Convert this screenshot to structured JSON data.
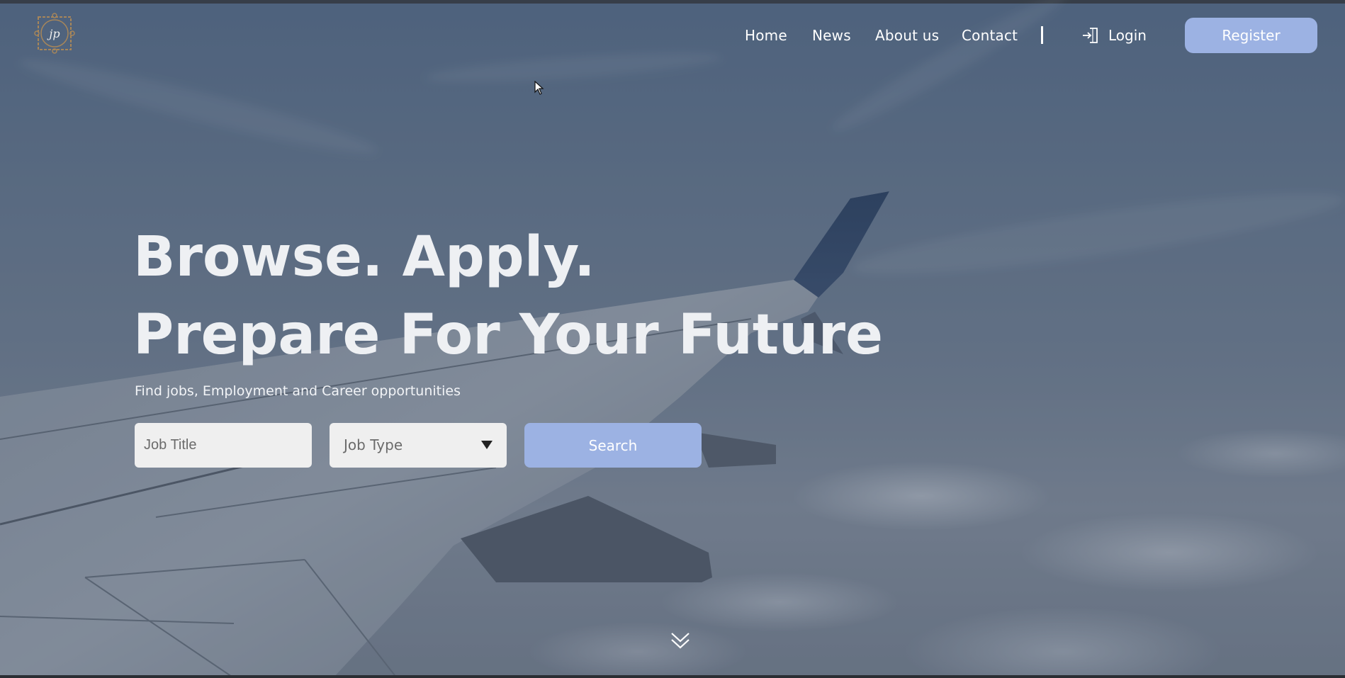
{
  "nav": {
    "items": [
      {
        "label": "Home"
      },
      {
        "label": "News"
      },
      {
        "label": "About us"
      },
      {
        "label": "Contact"
      }
    ],
    "login_label": "Login",
    "register_label": "Register",
    "logo_icon": "jp-monogram-logo",
    "login_icon": "sign-in-door-icon"
  },
  "hero": {
    "headline_line1": "Browse. Apply.",
    "headline_line2": "Prepare For Your Future",
    "subtitle": "Find jobs, Employment and Career opportunities"
  },
  "search": {
    "job_title_placeholder": "Job Title",
    "job_type_value": "Job Type",
    "search_label": "Search"
  },
  "colors": {
    "accent": "#9cb2e3",
    "text": "#ffffff",
    "input_bg": "#efefef"
  },
  "scroll_icon": "double-chevron-down-icon"
}
